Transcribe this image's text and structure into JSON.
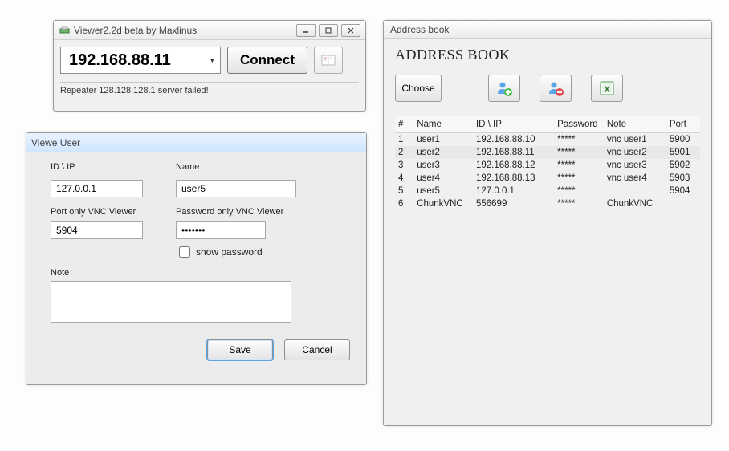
{
  "main": {
    "title": "Viewer2.2d beta by Maxlinus",
    "ip_value": "192.168.88.11",
    "connect_label": "Connect",
    "status_text": "Repeater 128.128.128.1 server failed!"
  },
  "user": {
    "title": "Viewe User",
    "labels": {
      "id_ip": "ID \\ IP",
      "name": "Name",
      "port": "Port only VNC Viewer",
      "password": "Password only VNC Viewer",
      "show_password": "show password",
      "note": "Note"
    },
    "values": {
      "id_ip": "127.0.0.1",
      "name": "user5",
      "port": "5904",
      "password": "•••••••",
      "note": ""
    },
    "buttons": {
      "save": "Save",
      "cancel": "Cancel"
    }
  },
  "book": {
    "title": "Address book",
    "heading": "ADDRESS BOOK",
    "choose_label": "Choose",
    "columns": [
      "#",
      "Name",
      "ID \\ IP",
      "Password",
      "Note",
      "Port"
    ],
    "rows": [
      {
        "n": "1",
        "name": "user1",
        "ip": "192.168.88.10",
        "pw": "*****",
        "note": "vnc user1",
        "port": "5900"
      },
      {
        "n": "2",
        "name": "user2",
        "ip": "192.168.88.11",
        "pw": "*****",
        "note": "vnc user2",
        "port": "5901"
      },
      {
        "n": "3",
        "name": "user3",
        "ip": "192.168.88.12",
        "pw": "*****",
        "note": "vnc user3",
        "port": "5902"
      },
      {
        "n": "4",
        "name": "user4",
        "ip": "192.168.88.13",
        "pw": "*****",
        "note": "vnc user4",
        "port": "5903"
      },
      {
        "n": "5",
        "name": "user5",
        "ip": "127.0.0.1",
        "pw": "*****",
        "note": "",
        "port": "5904"
      },
      {
        "n": "6",
        "name": "ChunkVNC",
        "ip": "556699",
        "pw": "*****",
        "note": "ChunkVNC",
        "port": ""
      }
    ]
  }
}
